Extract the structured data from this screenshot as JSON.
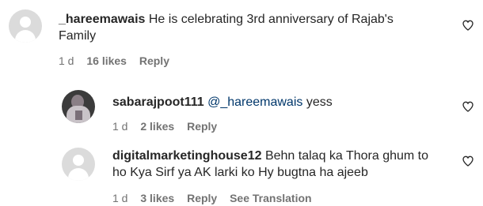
{
  "comments": [
    {
      "username": "_hareemawais",
      "text": "He is celebrating 3rd anniversary of Rajab's Family",
      "time": "1 d",
      "likes": "16 likes",
      "reply": "Reply"
    },
    {
      "username": "sabarajpoot111",
      "mention": "@_hareemawais",
      "text": " yess",
      "time": "1 d",
      "likes": "2 likes",
      "reply": "Reply"
    },
    {
      "username": "digitalmarketinghouse12",
      "text": "Behn talaq ka Thora ghum to ho Kya Sirf ya AK larki ko Hy bugtna ha ajeeb",
      "time": "1 d",
      "likes": "3 likes",
      "reply": "Reply",
      "translate": "See Translation"
    }
  ],
  "icons": {
    "like": "heart-outline-icon",
    "avatar_default": "default-avatar-icon"
  }
}
